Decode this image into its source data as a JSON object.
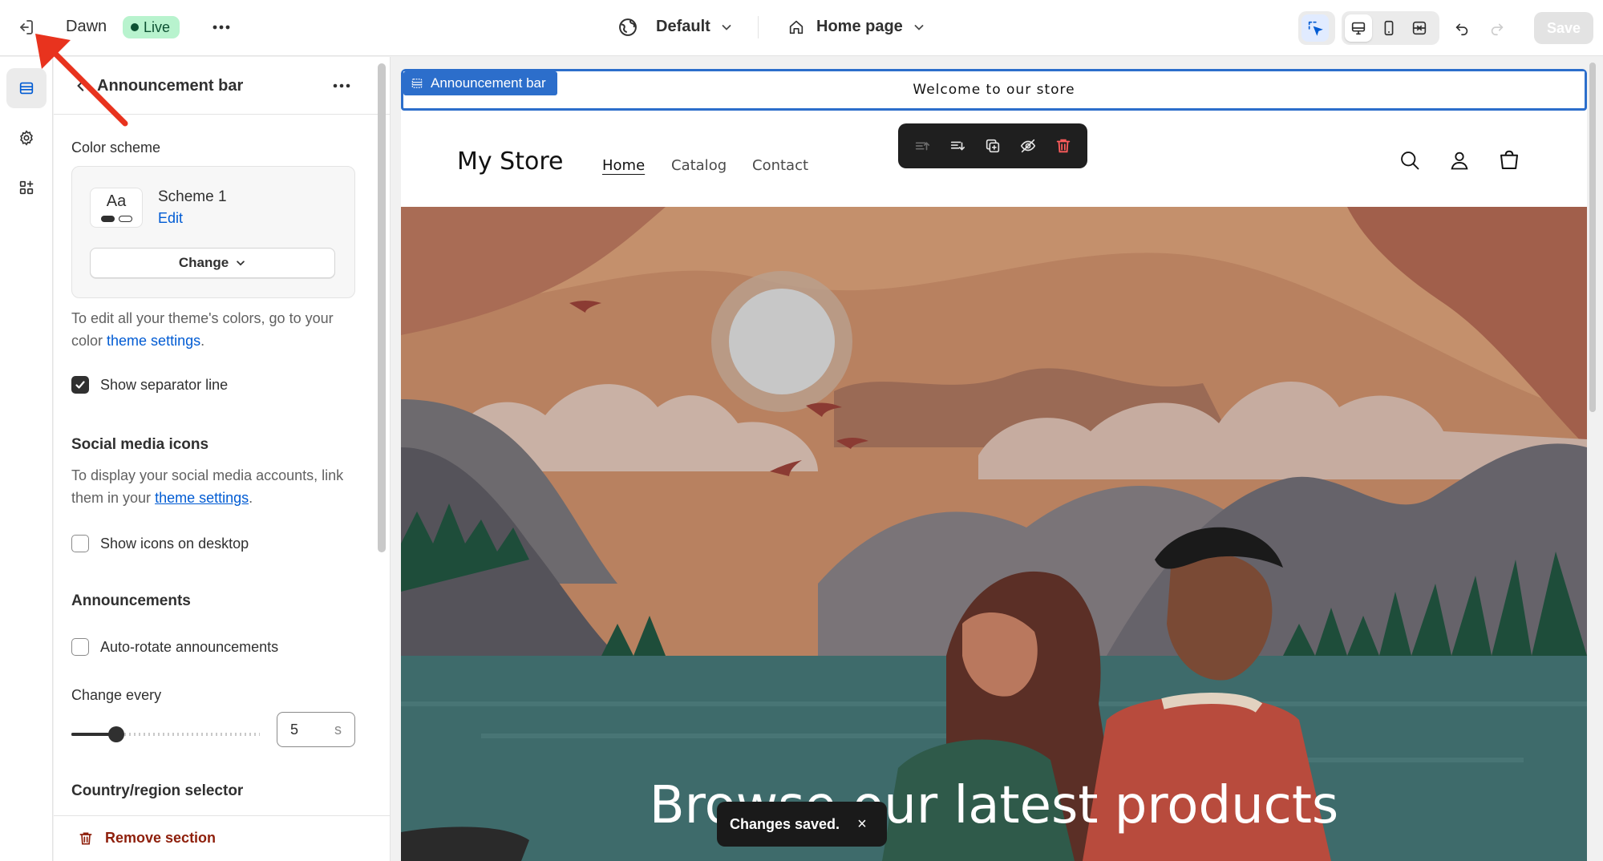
{
  "topbar": {
    "theme_name": "Dawn",
    "status_badge": "Live",
    "template_label": "Default",
    "page_label": "Home page",
    "save_label": "Save"
  },
  "panel": {
    "title": "Announcement bar",
    "color_scheme_label": "Color scheme",
    "scheme_name": "Scheme 1",
    "scheme_preview_text": "Aa",
    "scheme_edit_link": "Edit",
    "change_button": "Change",
    "color_help_prefix": "To edit all your theme's colors, go to your color",
    "color_help_link": "theme settings",
    "color_help_suffix": ".",
    "separator_label": "Show separator line",
    "separator_checked": true,
    "social_heading": "Social media icons",
    "social_help_prefix": "To display your social media accounts, link them in your",
    "social_help_link": "theme settings",
    "social_help_suffix": ".",
    "social_desktop_label": "Show icons on desktop",
    "social_desktop_checked": false,
    "announcements_heading": "Announcements",
    "autorotate_label": "Auto-rotate announcements",
    "autorotate_checked": false,
    "change_every_label": "Change every",
    "change_every_value": "5",
    "change_every_unit": "s",
    "change_every_slider_fraction": 0.24,
    "country_heading": "Country/region selector",
    "remove_section": "Remove section"
  },
  "preview": {
    "announcement_tag": "Announcement bar",
    "announcement_text": "Welcome to our store",
    "store_name": "My Store",
    "nav": [
      "Home",
      "Catalog",
      "Contact"
    ],
    "hero_heading": "Browse our latest products"
  },
  "toast": {
    "message": "Changes saved.",
    "close": "×"
  },
  "colors": {
    "accent_blue": "#2c6ecb",
    "live_badge_bg": "#b8f3ce",
    "danger": "#8e1f0b",
    "annotation_arrow": "#e8331e"
  }
}
